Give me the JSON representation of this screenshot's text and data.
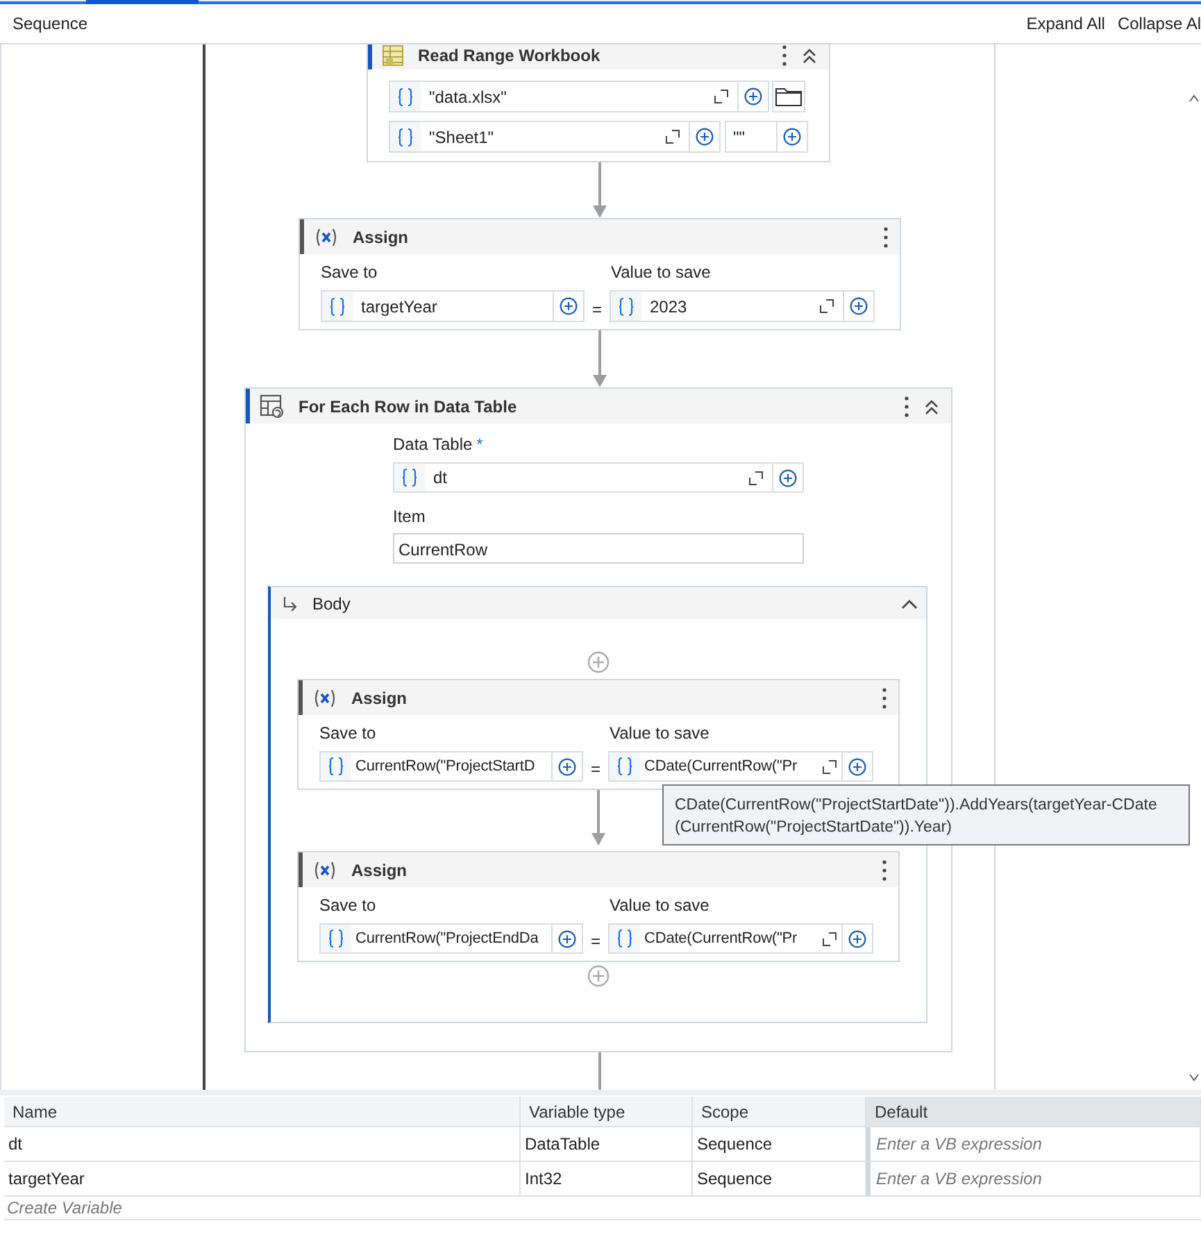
{
  "header": {
    "title": "Sequence",
    "actions": [
      "Expand All",
      "Collapse Al"
    ]
  },
  "sequence": [
    {
      "kind": "read_range",
      "title": "Read Range Workbook",
      "path": "\"data.xlsx\"",
      "sheet": "\"Sheet1\"",
      "range": "\"\""
    },
    {
      "kind": "assign",
      "title": "Assign",
      "save_to_label": "Save to",
      "save_to": "targetYear",
      "operator": "=",
      "value_label": "Value to save",
      "value": "2023"
    },
    {
      "kind": "for_each_row",
      "title": "For Each Row in Data Table",
      "data_table_label": "Data Table",
      "required_mark": "*",
      "data_table": "dt",
      "item_label": "Item",
      "item": "CurrentRow",
      "body": {
        "title": "Body",
        "expanded": true,
        "activities": [
          {
            "kind": "assign",
            "title": "Assign",
            "save_to_label": "Save to",
            "save_to": "CurrentRow(\"ProjectStartD",
            "operator": "=",
            "value_label": "Value to save",
            "value": "CDate(CurrentRow(\"Pr"
          },
          {
            "kind": "assign",
            "title": "Assign",
            "save_to_label": "Save to",
            "save_to": "CurrentRow(\"ProjectEndDa",
            "operator": "=",
            "value_label": "Value to save",
            "value": "CDate(CurrentRow(\"Pr"
          }
        ]
      }
    }
  ],
  "tooltip": {
    "lines": [
      "CDate(CurrentRow(\"ProjectStartDate\")).AddYears(targetYear-CDate",
      "(CurrentRow(\"ProjectStartDate\")).Year)"
    ]
  },
  "variables": {
    "columns": [
      "Name",
      "Variable type",
      "Scope",
      "Default"
    ],
    "rows": [
      {
        "name": "dt",
        "type": "DataTable",
        "scope": "Sequence",
        "default_placeholder": "Enter a VB expression"
      },
      {
        "name": "targetYear",
        "type": "Int32",
        "scope": "Sequence",
        "default_placeholder": "Enter a VB expression"
      }
    ],
    "create_placeholder": "Create Variable"
  }
}
